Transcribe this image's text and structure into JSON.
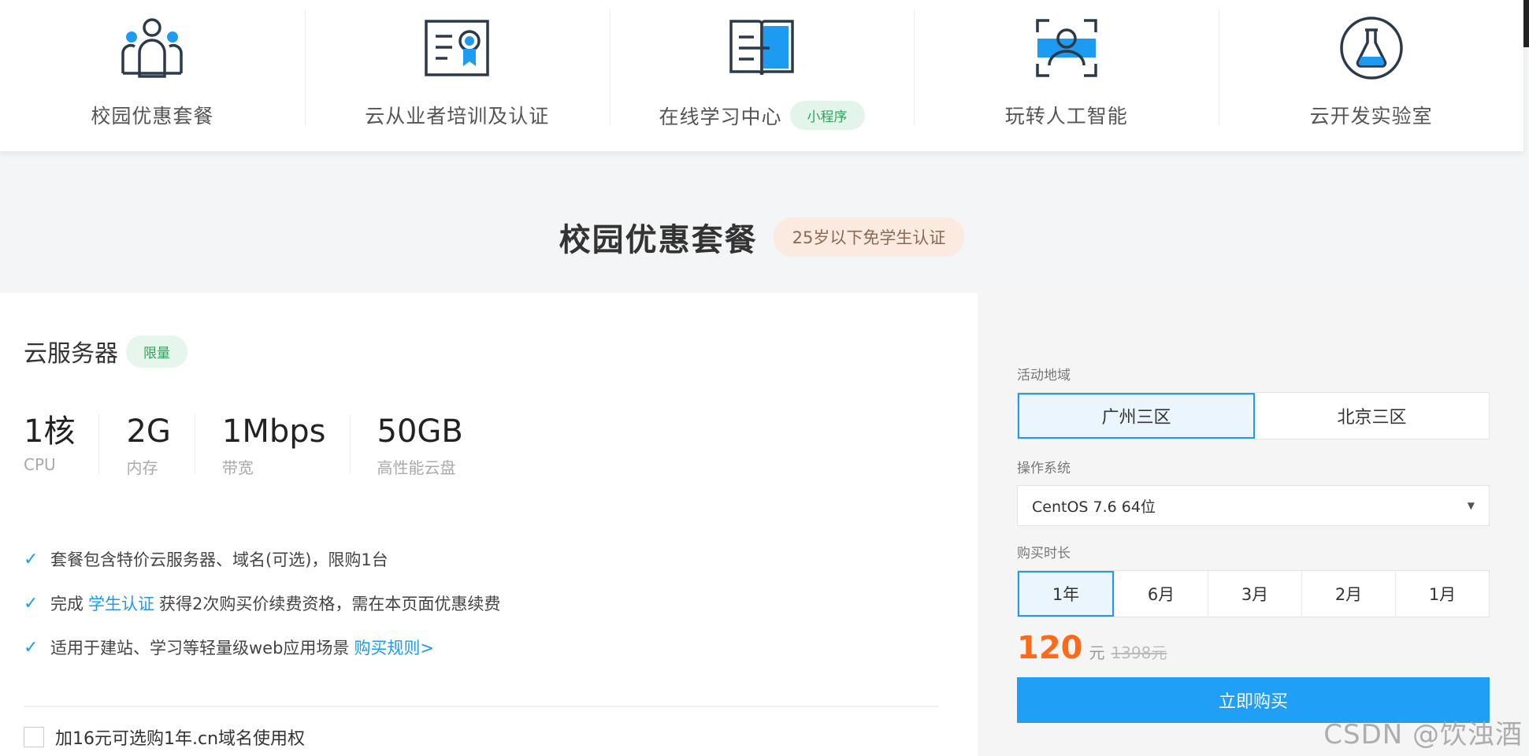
{
  "nav": {
    "items": [
      {
        "label": "校园优惠套餐",
        "icon": "group-users-icon"
      },
      {
        "label": "云从业者培训及认证",
        "icon": "certificate-icon"
      },
      {
        "label": "在线学习中心",
        "icon": "open-book-icon",
        "badge": "小程序"
      },
      {
        "label": "玩转人工智能",
        "icon": "face-scan-icon"
      },
      {
        "label": "云开发实验室",
        "icon": "flask-icon"
      }
    ]
  },
  "section": {
    "title": "校园优惠套餐",
    "badge": "25岁以下免学生认证"
  },
  "product": {
    "title": "云服务器",
    "badge": "限量",
    "specs": [
      {
        "value": "1核",
        "label": "CPU"
      },
      {
        "value": "2G",
        "label": "内存"
      },
      {
        "value": "1Mbps",
        "label": "带宽"
      },
      {
        "value": "50GB",
        "label": "高性能云盘"
      }
    ],
    "features": {
      "f1": "套餐包含特价云服务器、域名(可选)，限购1台",
      "f2_pre": "完成",
      "f2_link": "学生认证",
      "f2_post": "获得2次购买价续费资格，需在本页面优惠续费",
      "f3_pre": "适用于建站、学习等轻量级web应用场景",
      "f3_link": "购买规则>"
    },
    "addon": "加16元可选购1年.cn域名使用权"
  },
  "order": {
    "region_label": "活动地域",
    "regions": [
      "广州三区",
      "北京三区"
    ],
    "os_label": "操作系统",
    "os_value": "CentOS 7.6 64位",
    "duration_label": "购买时长",
    "durations": [
      "1年",
      "6月",
      "3月",
      "2月",
      "1月"
    ],
    "price": "120",
    "price_unit": "元",
    "original_price": "1398元",
    "buy_label": "立即购买"
  },
  "watermark": "CSDN @饮浊酒",
  "colors": {
    "accent": "#1d9bf0",
    "price": "#ff6a1a",
    "badge_green": "#2fa35a"
  }
}
